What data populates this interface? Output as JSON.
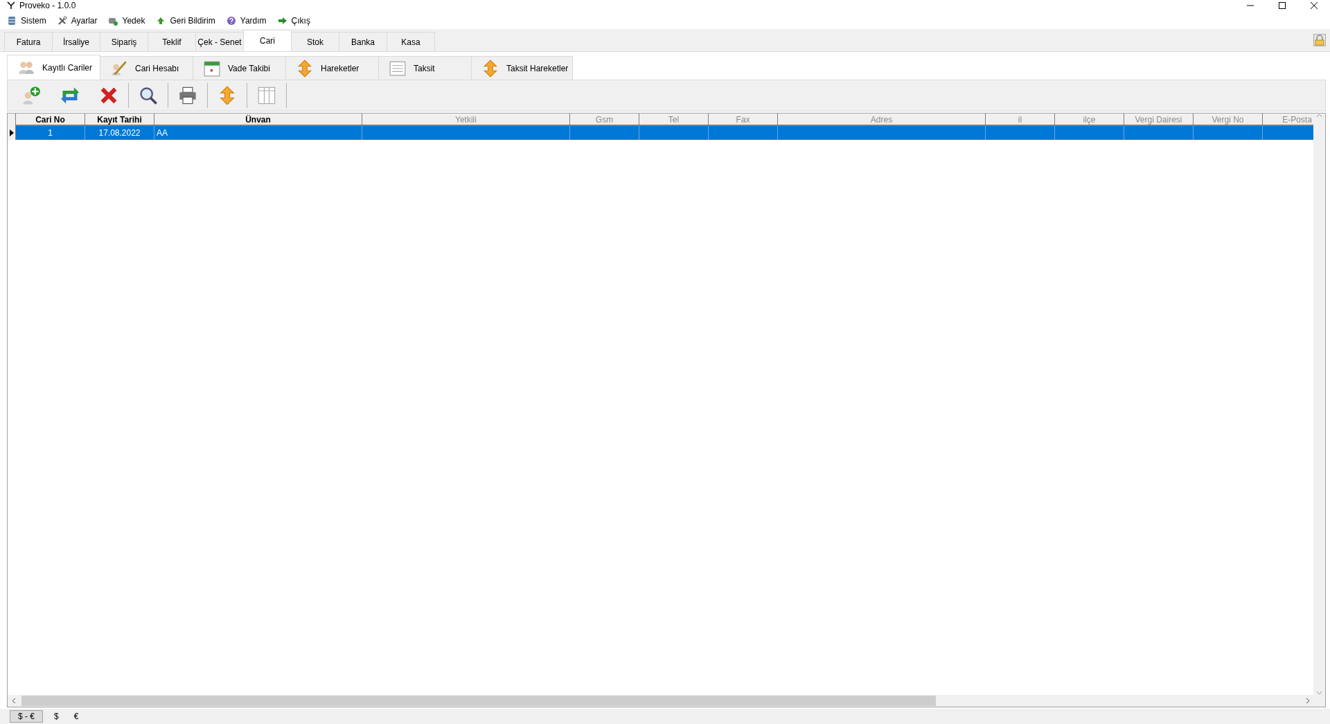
{
  "window": {
    "title": "Proveko - 1.0.0"
  },
  "menu": [
    {
      "label": "Sistem"
    },
    {
      "label": "Ayarlar"
    },
    {
      "label": "Yedek"
    },
    {
      "label": "Geri Bildirim"
    },
    {
      "label": "Yardım"
    },
    {
      "label": "Çıkış"
    }
  ],
  "tabs": [
    {
      "label": "Fatura",
      "selected": false
    },
    {
      "label": "İrsaliye",
      "selected": false
    },
    {
      "label": "Sipariş",
      "selected": false
    },
    {
      "label": "Teklif",
      "selected": false
    },
    {
      "label": "Çek - Senet",
      "selected": false
    },
    {
      "label": "Cari",
      "selected": true
    },
    {
      "label": "Stok",
      "selected": false
    },
    {
      "label": "Banka",
      "selected": false
    },
    {
      "label": "Kasa",
      "selected": false
    }
  ],
  "subtabs": [
    {
      "label": "Kayıtlı Cariler",
      "selected": true
    },
    {
      "label": "Cari Hesabı",
      "selected": false
    },
    {
      "label": "Vade Takibi",
      "selected": false
    },
    {
      "label": "Hareketler",
      "selected": false
    },
    {
      "label": "Taksit",
      "selected": false
    },
    {
      "label": "Taksit Hareketler",
      "selected": false
    }
  ],
  "table": {
    "columns": [
      {
        "label": "Cari No",
        "bold": true
      },
      {
        "label": "Kayıt Tarihi",
        "bold": true
      },
      {
        "label": "Ünvan",
        "bold": true
      },
      {
        "label": "Yetkili",
        "bold": false
      },
      {
        "label": "Gsm",
        "bold": false
      },
      {
        "label": "Tel",
        "bold": false
      },
      {
        "label": "Fax",
        "bold": false
      },
      {
        "label": "Adres",
        "bold": false
      },
      {
        "label": "il",
        "bold": false
      },
      {
        "label": "ilçe",
        "bold": false
      },
      {
        "label": "Vergi Dairesi",
        "bold": false
      },
      {
        "label": "Vergi No",
        "bold": false
      },
      {
        "label": "E-Posta",
        "bold": false
      }
    ],
    "rows": [
      {
        "selected": true,
        "cells": [
          "1",
          "17.08.2022",
          "AA",
          "",
          "",
          "",
          "",
          "",
          "",
          "",
          "",
          "",
          ""
        ]
      }
    ]
  },
  "status_bar": [
    {
      "label": "$ - €",
      "selected": true
    },
    {
      "label": "$",
      "selected": false
    },
    {
      "label": "€",
      "selected": false
    }
  ]
}
